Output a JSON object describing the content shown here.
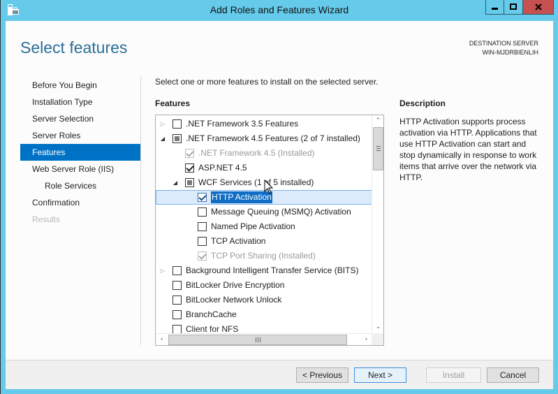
{
  "window": {
    "title": "Add Roles and Features Wizard",
    "icon": "server-manager-icon",
    "controls": {
      "minimize": "minimize-icon",
      "maximize": "maximize-icon",
      "close": "close-icon"
    }
  },
  "header": {
    "page_title": "Select features",
    "destination_label": "DESTINATION SERVER",
    "destination_server": "WIN-MJDRBIENLIH"
  },
  "nav": {
    "items": [
      {
        "label": "Before You Begin",
        "state": "normal"
      },
      {
        "label": "Installation Type",
        "state": "normal"
      },
      {
        "label": "Server Selection",
        "state": "normal"
      },
      {
        "label": "Server Roles",
        "state": "normal"
      },
      {
        "label": "Features",
        "state": "active"
      },
      {
        "label": "Web Server Role (IIS)",
        "state": "normal"
      },
      {
        "label": "Role Services",
        "state": "sub"
      },
      {
        "label": "Confirmation",
        "state": "normal"
      },
      {
        "label": "Results",
        "state": "disabled"
      }
    ]
  },
  "main": {
    "intro": "Select one or more features to install on the selected server.",
    "features_label": "Features",
    "tree": [
      {
        "label": ".NET Framework 3.5 Features",
        "level": 0,
        "expander": "collapsed",
        "check": "unchecked",
        "enabled": true
      },
      {
        "label": ".NET Framework 4.5 Features (2 of 7 installed)",
        "level": 0,
        "expander": "expanded",
        "check": "partial",
        "enabled": true
      },
      {
        "label": ".NET Framework 4.5 (Installed)",
        "level": 1,
        "expander": "none",
        "check": "checked",
        "enabled": false
      },
      {
        "label": "ASP.NET 4.5",
        "level": 1,
        "expander": "none",
        "check": "checked",
        "enabled": true
      },
      {
        "label": "WCF Services (1 of 5 installed)",
        "level": 1,
        "expander": "expanded",
        "check": "partial",
        "enabled": true
      },
      {
        "label": "HTTP Activation",
        "level": 2,
        "expander": "none",
        "check": "checked",
        "enabled": true,
        "selected": true
      },
      {
        "label": "Message Queuing (MSMQ) Activation",
        "level": 2,
        "expander": "none",
        "check": "unchecked",
        "enabled": true
      },
      {
        "label": "Named Pipe Activation",
        "level": 2,
        "expander": "none",
        "check": "unchecked",
        "enabled": true
      },
      {
        "label": "TCP Activation",
        "level": 2,
        "expander": "none",
        "check": "unchecked",
        "enabled": true
      },
      {
        "label": "TCP Port Sharing (Installed)",
        "level": 2,
        "expander": "none",
        "check": "checked",
        "enabled": false
      },
      {
        "label": "Background Intelligent Transfer Service (BITS)",
        "level": 0,
        "expander": "collapsed",
        "check": "unchecked",
        "enabled": true
      },
      {
        "label": "BitLocker Drive Encryption",
        "level": 0,
        "expander": "none",
        "check": "unchecked",
        "enabled": true
      },
      {
        "label": "BitLocker Network Unlock",
        "level": 0,
        "expander": "none",
        "check": "unchecked",
        "enabled": true
      },
      {
        "label": "BranchCache",
        "level": 0,
        "expander": "none",
        "check": "unchecked",
        "enabled": true
      },
      {
        "label": "Client for NFS",
        "level": 0,
        "expander": "none",
        "check": "unchecked",
        "enabled": true
      }
    ]
  },
  "description": {
    "title": "Description",
    "body": "HTTP Activation supports process activation via HTTP. Applications that use HTTP Activation can start and stop dynamically in response to work items that arrive over the network via HTTP."
  },
  "footer": {
    "previous": "< Previous",
    "next": "Next >",
    "install": "Install",
    "cancel": "Cancel"
  },
  "colors": {
    "chrome": "#66cbea",
    "accent": "#0072c6",
    "heading": "#2b6e95",
    "close": "#c75050"
  }
}
